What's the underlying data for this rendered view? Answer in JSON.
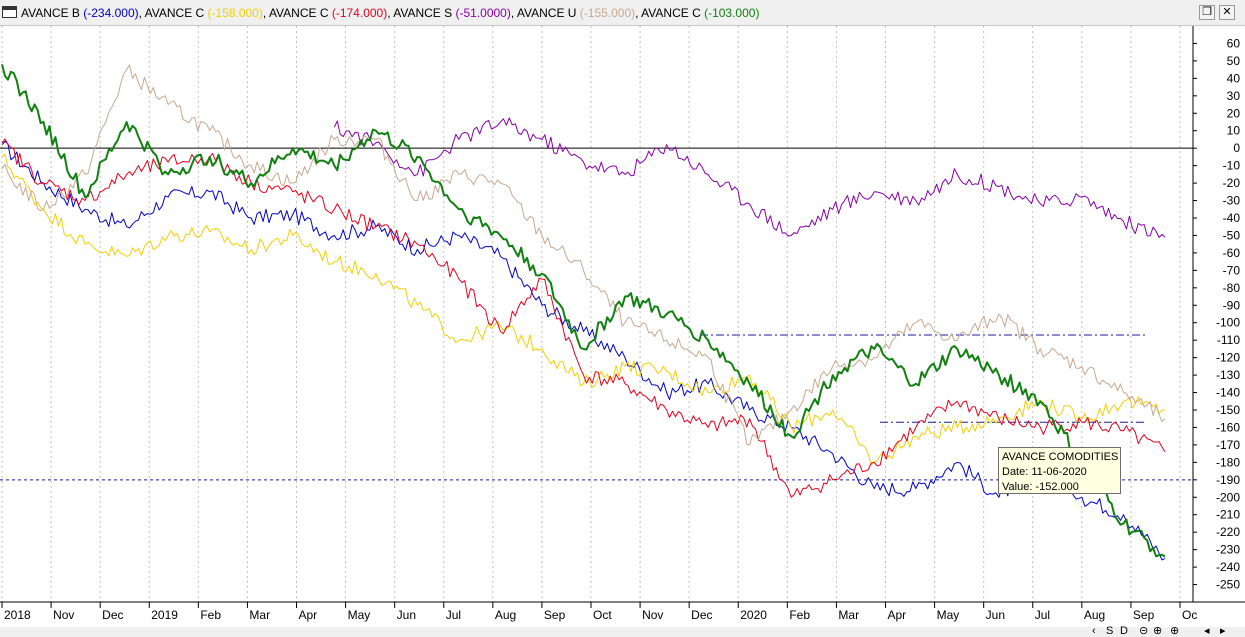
{
  "legend": [
    {
      "name": "AVANCE B",
      "value": "(-234.000)",
      "color": "#0000cc"
    },
    {
      "name": "AVANCE C",
      "value": "(-158.000)",
      "color": "#f2d000"
    },
    {
      "name": "AVANCE C",
      "value": "(-174.000)",
      "color": "#e8001c"
    },
    {
      "name": "AVANCE S",
      "value": "(-51.0000)",
      "color": "#8800aa"
    },
    {
      "name": "AVANCE U",
      "value": "(-155.000)",
      "color": "#c8a890"
    },
    {
      "name": "AVANCE C",
      "value": "(-103.000)",
      "color": "#108010"
    }
  ],
  "tooltip": {
    "name": "AVANCE COMODITIES",
    "date": "Date: 11-06-2020",
    "value": "Value: -152.000"
  },
  "nav": {
    "s": "S",
    "d": "D"
  },
  "chart_data": {
    "type": "line",
    "ylim": [
      -260,
      70
    ],
    "yticks": [
      60,
      50,
      40,
      30,
      20,
      10,
      0,
      -10,
      -20,
      -30,
      -40,
      -50,
      -60,
      -70,
      -80,
      -90,
      -100,
      -110,
      -120,
      -130,
      -140,
      -150,
      -160,
      -170,
      -180,
      -190,
      -200,
      -210,
      -220,
      -230,
      -240,
      -250
    ],
    "xticks": [
      "2018",
      "Nov",
      "Dec",
      "2019",
      "Feb",
      "Mar",
      "Apr",
      "May",
      "Jun",
      "Jul",
      "Aug",
      "Sep",
      "Oct",
      "Nov",
      "Dec",
      "2020",
      "Feb",
      "Mar",
      "Apr",
      "May",
      "Jun",
      "Jul",
      "Aug",
      "Sep",
      "Oc"
    ],
    "hlines": [
      {
        "y": 0,
        "color": "#000000",
        "style": "solid"
      },
      {
        "y": -190,
        "color": "#1a1aa0",
        "style": "dashed"
      },
      {
        "y": -107,
        "color": "#1a1aa0",
        "style": "dashdot"
      },
      {
        "y": -157,
        "color": "#1a1aa0",
        "style": "dashdot"
      }
    ],
    "series": [
      {
        "name": "AVANCE B",
        "color": "#0000cc",
        "width": 1,
        "points": [
          [
            0,
            2
          ],
          [
            1,
            -20
          ],
          [
            2,
            -35
          ],
          [
            3,
            -45
          ],
          [
            4,
            -28
          ],
          [
            5,
            -25
          ],
          [
            6,
            -40
          ],
          [
            7,
            -38
          ],
          [
            8,
            -50
          ],
          [
            9,
            -45
          ],
          [
            10,
            -58
          ],
          [
            11,
            -50
          ],
          [
            12,
            -62
          ],
          [
            13,
            -90
          ],
          [
            14,
            -105
          ],
          [
            15,
            -120
          ],
          [
            16,
            -140
          ],
          [
            17,
            -135
          ],
          [
            18,
            -150
          ],
          [
            19,
            -160
          ],
          [
            20,
            -175
          ],
          [
            21,
            -195
          ],
          [
            22,
            -195
          ],
          [
            23,
            -180
          ],
          [
            24,
            -200
          ],
          [
            25,
            -180
          ],
          [
            26,
            -200
          ],
          [
            27,
            -210
          ],
          [
            28,
            -235
          ]
        ]
      },
      {
        "name": "AVANCE C",
        "color": "#f2d000",
        "width": 1,
        "points": [
          [
            0,
            -5
          ],
          [
            1,
            -35
          ],
          [
            2,
            -55
          ],
          [
            3,
            -62
          ],
          [
            4,
            -50
          ],
          [
            5,
            -48
          ],
          [
            6,
            -58
          ],
          [
            7,
            -50
          ],
          [
            8,
            -65
          ],
          [
            9,
            -72
          ],
          [
            10,
            -90
          ],
          [
            11,
            -110
          ],
          [
            12,
            -102
          ],
          [
            13,
            -115
          ],
          [
            14,
            -135
          ],
          [
            15,
            -125
          ],
          [
            16,
            -128
          ],
          [
            17,
            -140
          ],
          [
            18,
            -130
          ],
          [
            19,
            -160
          ],
          [
            20,
            -150
          ],
          [
            21,
            -180
          ],
          [
            22,
            -165
          ],
          [
            23,
            -160
          ],
          [
            24,
            -155
          ],
          [
            25,
            -145
          ],
          [
            26,
            -155
          ],
          [
            27,
            -145
          ],
          [
            28,
            -150
          ]
        ]
      },
      {
        "name": "AVANCE C",
        "color": "#e8001c",
        "width": 1,
        "points": [
          [
            0,
            3
          ],
          [
            1,
            -20
          ],
          [
            2,
            -30
          ],
          [
            3,
            -15
          ],
          [
            4,
            -8
          ],
          [
            5,
            -5
          ],
          [
            6,
            -20
          ],
          [
            7,
            -25
          ],
          [
            8,
            -35
          ],
          [
            9,
            -45
          ],
          [
            10,
            -55
          ],
          [
            11,
            -75
          ],
          [
            12,
            -105
          ],
          [
            13,
            -75
          ],
          [
            14,
            -130
          ],
          [
            15,
            -135
          ],
          [
            16,
            -150
          ],
          [
            17,
            -160
          ],
          [
            18,
            -155
          ],
          [
            19,
            -200
          ],
          [
            20,
            -190
          ],
          [
            21,
            -180
          ],
          [
            22,
            -160
          ],
          [
            23,
            -145
          ],
          [
            24,
            -155
          ],
          [
            25,
            -160
          ],
          [
            26,
            -157
          ],
          [
            27,
            -162
          ],
          [
            28,
            -174
          ]
        ]
      },
      {
        "name": "AVANCE S",
        "color": "#8800aa",
        "width": 1,
        "points": [
          [
            8,
            12
          ],
          [
            9,
            3
          ],
          [
            10,
            -15
          ],
          [
            11,
            5
          ],
          [
            12,
            15
          ],
          [
            13,
            5
          ],
          [
            14,
            -8
          ],
          [
            15,
            -15
          ],
          [
            16,
            2
          ],
          [
            17,
            -15
          ],
          [
            18,
            -32
          ],
          [
            19,
            -50
          ],
          [
            20,
            -35
          ],
          [
            21,
            -25
          ],
          [
            22,
            -30
          ],
          [
            23,
            -15
          ],
          [
            24,
            -22
          ],
          [
            25,
            -32
          ],
          [
            26,
            -28
          ],
          [
            27,
            -42
          ],
          [
            28,
            -51
          ]
        ]
      },
      {
        "name": "AVANCE U",
        "color": "#c8a890",
        "width": 1,
        "points": [
          [
            0,
            -12
          ],
          [
            1,
            -35
          ],
          [
            2,
            -15
          ],
          [
            3,
            45
          ],
          [
            4,
            25
          ],
          [
            5,
            10
          ],
          [
            6,
            -10
          ],
          [
            7,
            -20
          ],
          [
            8,
            5
          ],
          [
            9,
            5
          ],
          [
            10,
            -30
          ],
          [
            11,
            -15
          ],
          [
            12,
            -20
          ],
          [
            13,
            -50
          ],
          [
            14,
            -70
          ],
          [
            15,
            -100
          ],
          [
            16,
            -110
          ],
          [
            17,
            -120
          ],
          [
            18,
            -170
          ],
          [
            19,
            -150
          ],
          [
            20,
            -125
          ],
          [
            21,
            -120
          ],
          [
            22,
            -100
          ],
          [
            23,
            -110
          ],
          [
            24,
            -95
          ],
          [
            25,
            -115
          ],
          [
            26,
            -125
          ],
          [
            27,
            -140
          ],
          [
            28,
            -155
          ]
        ]
      },
      {
        "name": "AVANCE C",
        "color": "#108010",
        "width": 2,
        "points": [
          [
            0,
            48
          ],
          [
            1,
            15
          ],
          [
            2,
            -28
          ],
          [
            3,
            15
          ],
          [
            4,
            -15
          ],
          [
            5,
            -5
          ],
          [
            6,
            -20
          ],
          [
            7,
            0
          ],
          [
            8,
            -10
          ],
          [
            9,
            10
          ],
          [
            10,
            -5
          ],
          [
            11,
            -35
          ],
          [
            12,
            -50
          ],
          [
            13,
            -72
          ],
          [
            14,
            -115
          ],
          [
            15,
            -85
          ],
          [
            16,
            -95
          ],
          [
            17,
            -110
          ],
          [
            18,
            -135
          ],
          [
            19,
            -165
          ],
          [
            20,
            -130
          ],
          [
            21,
            -115
          ],
          [
            22,
            -135
          ],
          [
            23,
            -115
          ],
          [
            24,
            -130
          ],
          [
            25,
            -145
          ],
          [
            26,
            -180
          ],
          [
            27,
            -215
          ],
          [
            28,
            -234
          ]
        ]
      }
    ]
  }
}
